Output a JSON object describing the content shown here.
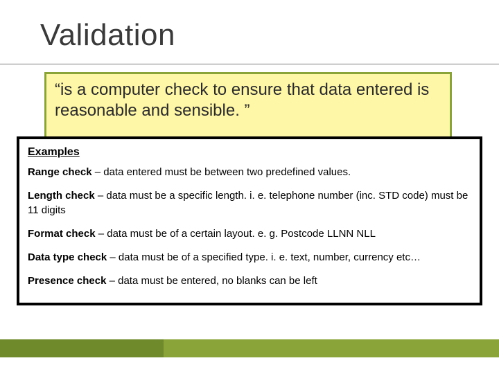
{
  "title": "Validation",
  "definition": "“is a computer check to ensure that data entered is reasonable and sensible. ”",
  "examples": {
    "heading": "Examples",
    "items": [
      {
        "name": "Range check",
        "desc": " – data entered must be between two predefined values."
      },
      {
        "name": "Length check",
        "desc": " – data must be a specific length. i. e. telephone number (inc. STD code) must be 11 digits"
      },
      {
        "name": "Format check",
        "desc": " – data must be of a certain layout. e. g. Postcode LLNN NLL"
      },
      {
        "name": "Data type check",
        "desc": " – data must be of a specified type. i. e. text, number, currency etc…"
      },
      {
        "name": "Presence check",
        "desc": " – data must be entered, no blanks can be left"
      }
    ]
  },
  "colors": {
    "accent": "#8aa43a",
    "accent_dark": "#6f8a2b",
    "callout_bg": "#fff7a8"
  }
}
